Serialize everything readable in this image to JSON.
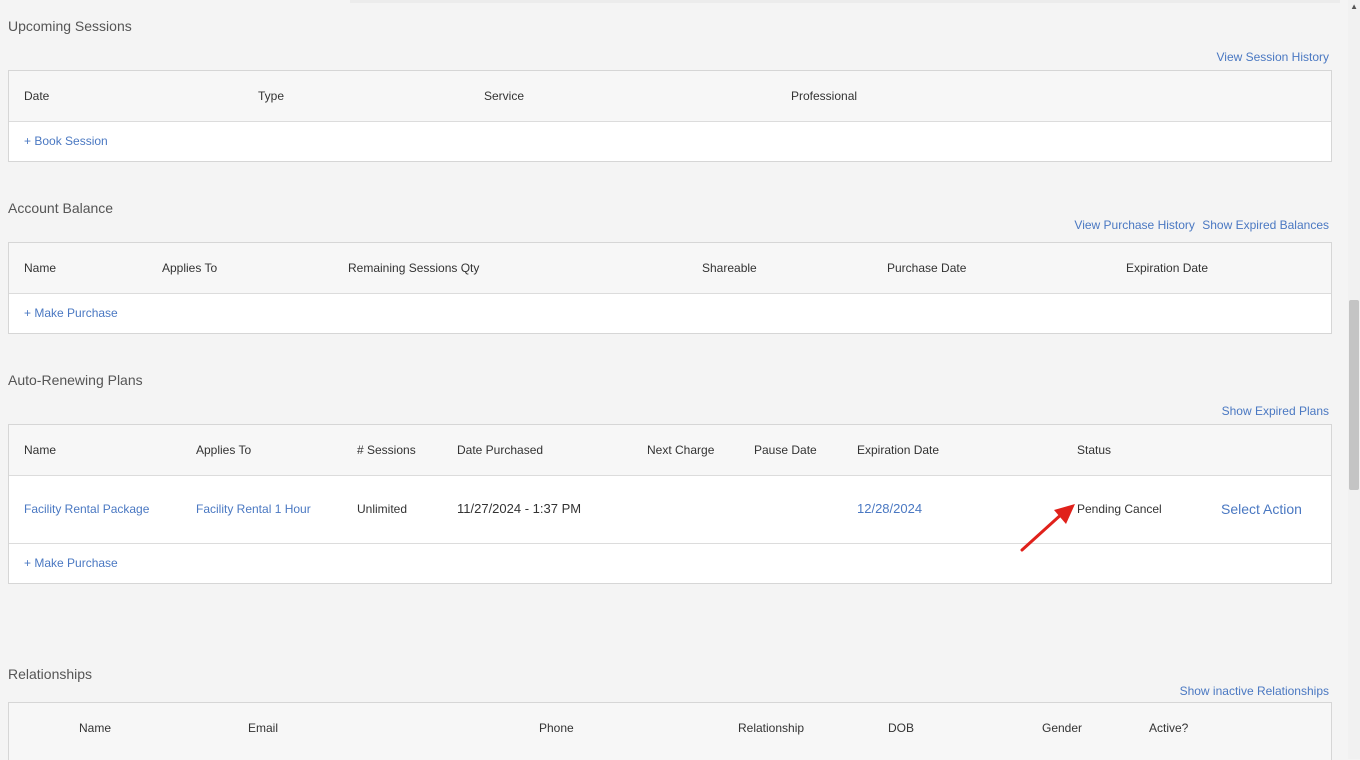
{
  "upcoming": {
    "title": "Upcoming Sessions",
    "link_history": "View Session History",
    "headers": [
      "Date",
      "Type",
      "Service",
      "Professional"
    ],
    "book_label": "+ Book Session"
  },
  "balance": {
    "title": "Account Balance",
    "link_purchase_history": "View Purchase History",
    "link_expired": "Show Expired Balances",
    "headers": [
      "Name",
      "Applies To",
      "Remaining Sessions Qty",
      "Shareable",
      "Purchase Date",
      "Expiration Date"
    ],
    "make_purchase_label": "+ Make Purchase"
  },
  "plans": {
    "title": "Auto-Renewing Plans",
    "link_expired": "Show Expired Plans",
    "headers": [
      "Name",
      "Applies To",
      "# Sessions",
      "Date Purchased",
      "Next Charge",
      "Pause Date",
      "Expiration Date",
      "Status"
    ],
    "row": {
      "name": "Facility Rental Package",
      "applies_to": "Facility Rental 1 Hour",
      "sessions": "Unlimited",
      "date_purchased": "11/27/2024 - 1:37 PM",
      "next_charge": "",
      "pause_date": "",
      "expiration_date": "12/28/2024",
      "status": "Pending Cancel",
      "action": "Select Action"
    },
    "make_purchase_label": "+ Make Purchase"
  },
  "relationships": {
    "title": "Relationships",
    "link_inactive": "Show inactive Relationships",
    "headers": [
      "Name",
      "Email",
      "Phone",
      "Relationship",
      "DOB",
      "Gender",
      "Active?"
    ]
  },
  "colors": {
    "link": "#4a78c2",
    "arrow": "#e0211b"
  }
}
